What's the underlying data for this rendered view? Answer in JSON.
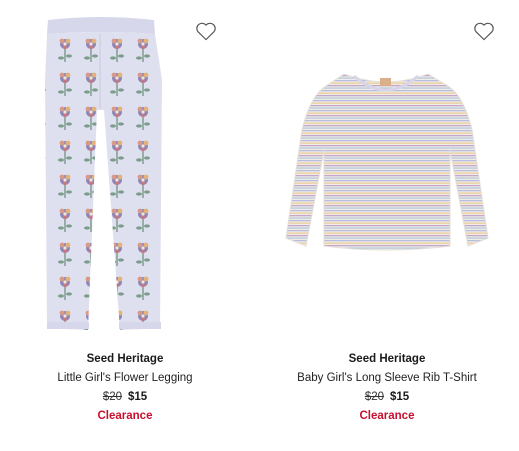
{
  "products": [
    {
      "brand": "Seed Heritage",
      "name": "Little Girl's Flower Legging",
      "original_price": "$20",
      "sale_price": "$15",
      "badge": "Clearance",
      "favorite_icon": "heart-outline-icon",
      "image": "flower-print-legging"
    },
    {
      "brand": "Seed Heritage",
      "name": "Baby Girl's Long Sleeve Rib T-Shirt",
      "original_price": "$20",
      "sale_price": "$15",
      "badge": "Clearance",
      "favorite_icon": "heart-outline-icon",
      "image": "striped-long-sleeve-tshirt"
    }
  ],
  "colors": {
    "badge": "#c8102e",
    "text": "#1a1a1a",
    "background": "#ffffff"
  }
}
